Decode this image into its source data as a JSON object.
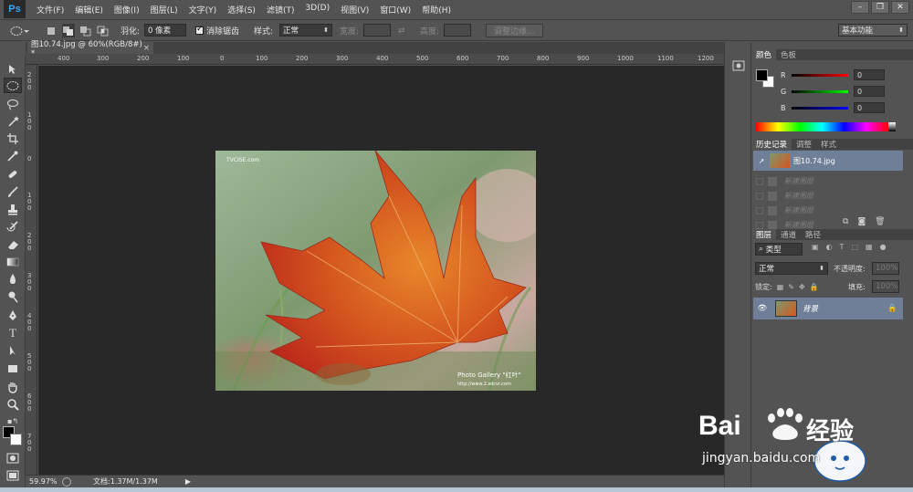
{
  "app": {
    "logo": "Ps",
    "menu": [
      "文件(F)",
      "编辑(E)",
      "图像(I)",
      "图层(L)",
      "文字(Y)",
      "选择(S)",
      "滤镜(T)",
      "3D(D)",
      "视图(V)",
      "窗口(W)",
      "帮助(H)"
    ]
  },
  "options": {
    "feather_label": "羽化:",
    "feather_value": "0 像素",
    "antialias_label": "消除锯齿",
    "style_label": "样式:",
    "style_value": "正常",
    "width_label": "宽度:",
    "height_label": "高度:",
    "refine_edge": "调整边缘...",
    "workspace": "基本功能"
  },
  "document": {
    "tab_title": "图10.74.jpg @ 60%(RGB/8#) *",
    "photo_watermark_top": "TVCISE.com",
    "photo_watermark_bottom1": "Photo Gallery \"红叶\"",
    "photo_watermark_bottom2": "http://www.2.sdcvr.com"
  },
  "ruler": {
    "h_ticks": [
      "400",
      "300",
      "200",
      "100",
      "0",
      "100",
      "200",
      "300",
      "400",
      "500",
      "600",
      "700",
      "800",
      "900",
      "1000",
      "1100",
      "1200"
    ],
    "v_ticks": [
      "200",
      "100",
      "0",
      "100",
      "200",
      "300",
      "400",
      "500",
      "600",
      "700"
    ]
  },
  "status": {
    "zoom": "59.97%",
    "doc_info": "文档:1.37M/1.37M"
  },
  "panels": {
    "color_tabs": [
      "颜色",
      "色板"
    ],
    "r_label": "R",
    "g_label": "G",
    "b_label": "B",
    "r_value": "0",
    "g_value": "0",
    "b_value": "0",
    "history_tabs": [
      "历史记录",
      "调整",
      "样式"
    ],
    "history_snapshot": "图10.74.jpg",
    "history_items": [
      "新建图层",
      "新建图层",
      "新建图层",
      "新建图层"
    ],
    "layer_tabs": [
      "图层",
      "通道",
      "路径"
    ],
    "layer_filter": "类型",
    "blend_mode": "正常",
    "opacity_label": "不透明度:",
    "opacity_value": "100%",
    "lock_label": "锁定:",
    "fill_label": "填充:",
    "fill_value": "100%",
    "layer_name": "背景"
  },
  "watermark": {
    "brand": "Bai",
    "brand2": "经验",
    "url": "jingyan.baidu.com"
  },
  "colors": {
    "accent": "#31a8ff",
    "selected_row": "#6f7f97",
    "canvas_bg": "#282828",
    "ui_bg": "#535353"
  }
}
